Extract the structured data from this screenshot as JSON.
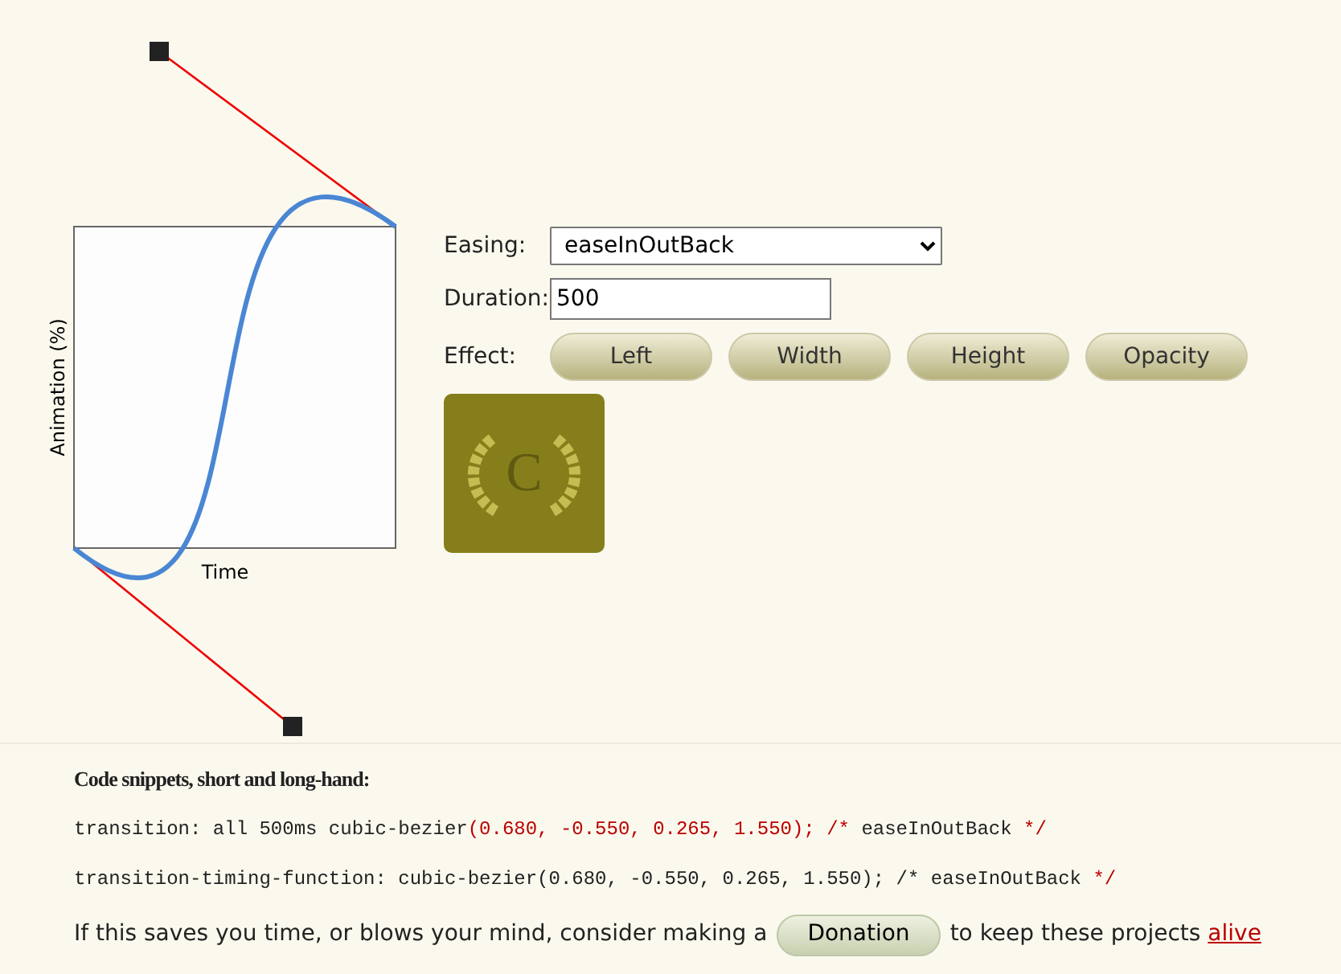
{
  "diagram": {
    "xlabel": "Time",
    "ylabel": "Animation (%)"
  },
  "form": {
    "easing_label": "Easing:",
    "easing_value": "easeInOutBack",
    "duration_label": "Duration:",
    "duration_value": "500",
    "effect_label": "Effect:",
    "effects": [
      "Left",
      "Width",
      "Height",
      "Opacity"
    ]
  },
  "preview": {
    "letter": "C"
  },
  "snippets": {
    "heading": "Code snippets, short and long-hand:",
    "lines": [
      [
        {
          "text": "transition: all 500ms cubic-bezier",
          "accent": false
        },
        {
          "text": "(0.680, -0.550, 0.265, 1.550); /* ",
          "accent": true
        },
        {
          "text": "easeInOutBack",
          "accent": false
        },
        {
          "text": " */",
          "accent": true
        }
      ],
      [
        {
          "text": "transition-timing-function: cubic-bezier(0.680, -0.550, 0.265, 1.550); /* easeInOutBack ",
          "accent": false
        },
        {
          "text": "*/",
          "accent": true
        }
      ]
    ]
  },
  "footer": {
    "before": "If this saves you time, or blows your mind, consider making a",
    "button": "Donation",
    "after": "to keep these projects",
    "link": "alive"
  }
}
